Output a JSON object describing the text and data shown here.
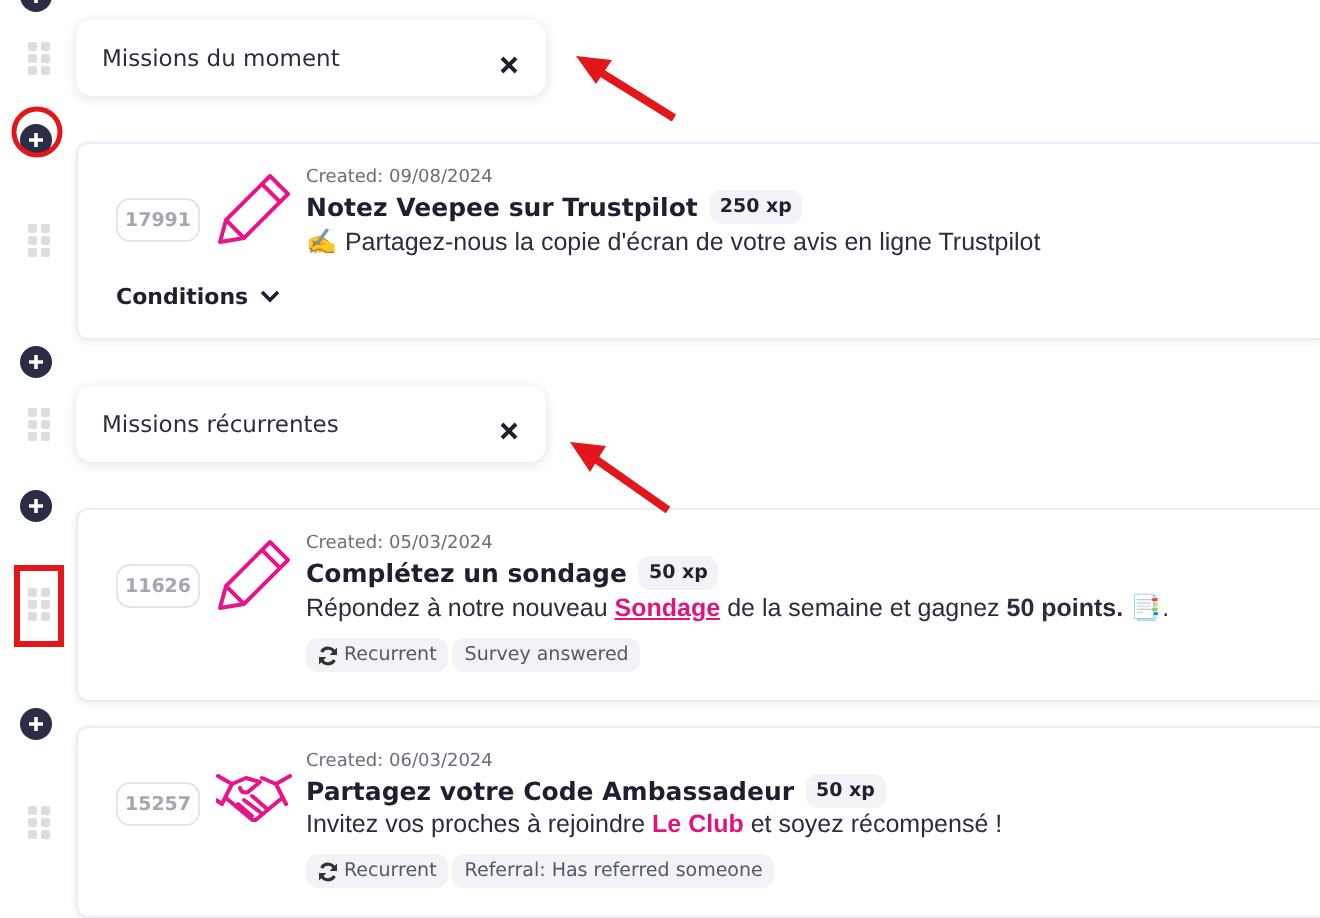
{
  "items": [
    {
      "kind": "header",
      "title": "Missions du moment"
    },
    {
      "kind": "mission",
      "id": "17991",
      "created": "Created: 09/08/2024",
      "title": "Notez Veepee sur Trustpilot",
      "xp": "250 xp",
      "description": [
        {
          "kind": "text",
          "text": "✍️ Partagez-nous la copie d'écran de votre avis en ligne Trustpilot"
        }
      ],
      "conditions": "Conditions"
    },
    {
      "kind": "header",
      "title": "Missions récurrentes"
    },
    {
      "kind": "mission",
      "id": "11626",
      "created": "Created: 05/03/2024",
      "title": "Complétez un sondage",
      "xp": "50 xp",
      "description": [
        {
          "kind": "text",
          "text": "Répondez à notre nouveau "
        },
        {
          "kind": "link",
          "text": "Sondage"
        },
        {
          "kind": "text",
          "text": " de la semaine et gagnez "
        },
        {
          "kind": "bold",
          "text": "50 points."
        },
        {
          "kind": "text",
          "text": " 📑."
        }
      ],
      "tags": [
        {
          "kind": "recurrent",
          "label": "Recurrent"
        },
        {
          "kind": "plain",
          "label": "Survey answered"
        }
      ]
    },
    {
      "kind": "mission",
      "id": "15257",
      "created": "Created: 06/03/2024",
      "title": "Partagez votre Code Ambassadeur",
      "xp": "50 xp",
      "description": [
        {
          "kind": "text",
          "text": "Invitez vos proches à rejoindre "
        },
        {
          "kind": "highlight",
          "text": "Le Club"
        },
        {
          "kind": "text",
          "text": " et soyez récompensé !"
        }
      ],
      "tags": [
        {
          "kind": "recurrent",
          "label": "Recurrent"
        },
        {
          "kind": "plain",
          "label": "Referral: Has referred someone"
        }
      ]
    }
  ]
}
